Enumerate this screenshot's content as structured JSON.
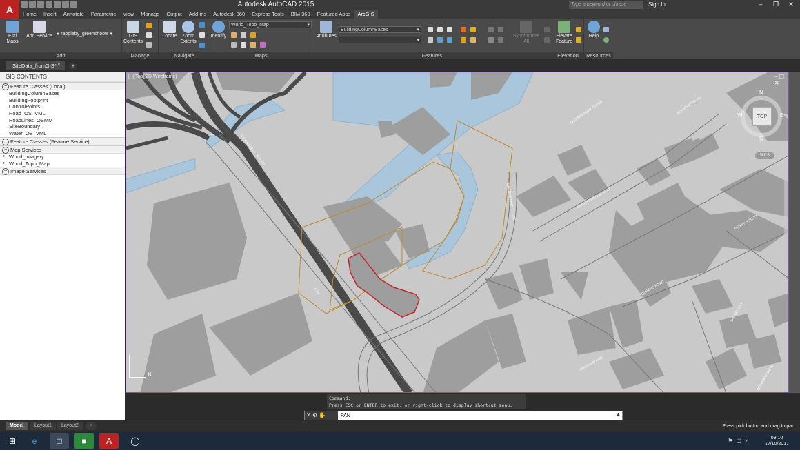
{
  "app": {
    "title": "Autodesk AutoCAD 2015",
    "app_button": "A",
    "search_placeholder": "Type a keyword or phrase",
    "signin": "Sign In"
  },
  "ribbon_tabs": [
    "Home",
    "Insert",
    "Annotate",
    "Parametric",
    "View",
    "Manage",
    "Output",
    "Add-ins",
    "Autodesk 360",
    "Express Tools",
    "BIM 360",
    "Featured Apps",
    "ArcGIS"
  ],
  "active_tab": "ArcGIS",
  "ribbon": {
    "add": {
      "title": "Add",
      "esri_maps": "Esri Maps",
      "add_service": "Add Service",
      "user": "rappleby_greenshoots"
    },
    "manage": {
      "title": "Manage",
      "gis_contents": "GIS Contents"
    },
    "navigate": {
      "title": "Navigate",
      "locate": "Locate",
      "zoom_extents": "Zoom Extents",
      "identify": "Identify"
    },
    "maps": {
      "title": "Maps",
      "basemap": "World_Topo_Map"
    },
    "features": {
      "title": "Features",
      "attributes": "Attributes",
      "feature_class": "BuildingColumnBases",
      "synchronize": "Synchronize All"
    },
    "elevation": {
      "title": "Elevation",
      "elevate_feature": "Elevate Feature"
    },
    "resources": {
      "title": "Resources",
      "help": "Help"
    }
  },
  "doc_tab": {
    "name": "SiteData_fromGIS*"
  },
  "gis_contents": {
    "header": "GIS CONTENTS",
    "groups": [
      {
        "label": "Feature Classes (Local)",
        "items": [
          "BuildingColumnBases",
          "BuildingFootprint",
          "ControlPoints",
          "Road_OS_VML",
          "RoadLines_OSMM",
          "SiteBoundary",
          "Water_OS_VML"
        ]
      },
      {
        "label": "Feature Classes (Feature Service)",
        "items": []
      },
      {
        "label": "Map Services",
        "items": [
          "World_Imagery",
          "World_Topo_Map"
        ]
      },
      {
        "label": "Image Services",
        "items": []
      }
    ]
  },
  "viewport": {
    "label": "[−][Top][2D Wireframe]",
    "viewcube_top": "TOP",
    "compass": {
      "n": "N",
      "s": "S",
      "e": "E",
      "w": "W"
    },
    "ucs": "WCS",
    "road_labels": [
      "A38",
      "A38",
      "CRESWELL ROAD",
      "OLD BREWERY CLOSE",
      "BEAUFORT ROAD",
      "BEAUCHAMPS STREET",
      "PENNY STREET",
      "QUEENS ROAD",
      "LAUREL WAY",
      "OLD BREWERY CLOSE",
      "REDWOOD DRIVE",
      "COSTA SQUARE"
    ]
  },
  "command": {
    "history_1": "Command:",
    "history_2": "Press ESC or ENTER to exit, or right-click to display shortcut menu.",
    "current": "PAN"
  },
  "layout_tabs": [
    "Model",
    "Layout1",
    "Layout2"
  ],
  "status_message": "Press pick button and drag to pan.",
  "clock": {
    "time": "09:10",
    "date": "17/10/2017"
  },
  "colors": {
    "water": "#a9c6dc",
    "buildings": "#9e9e9e",
    "map_bg": "#c9c9c9",
    "road": "#4a4a4a",
    "site_boundary": "#c08a2a",
    "building_footprint": "#c0282d"
  }
}
